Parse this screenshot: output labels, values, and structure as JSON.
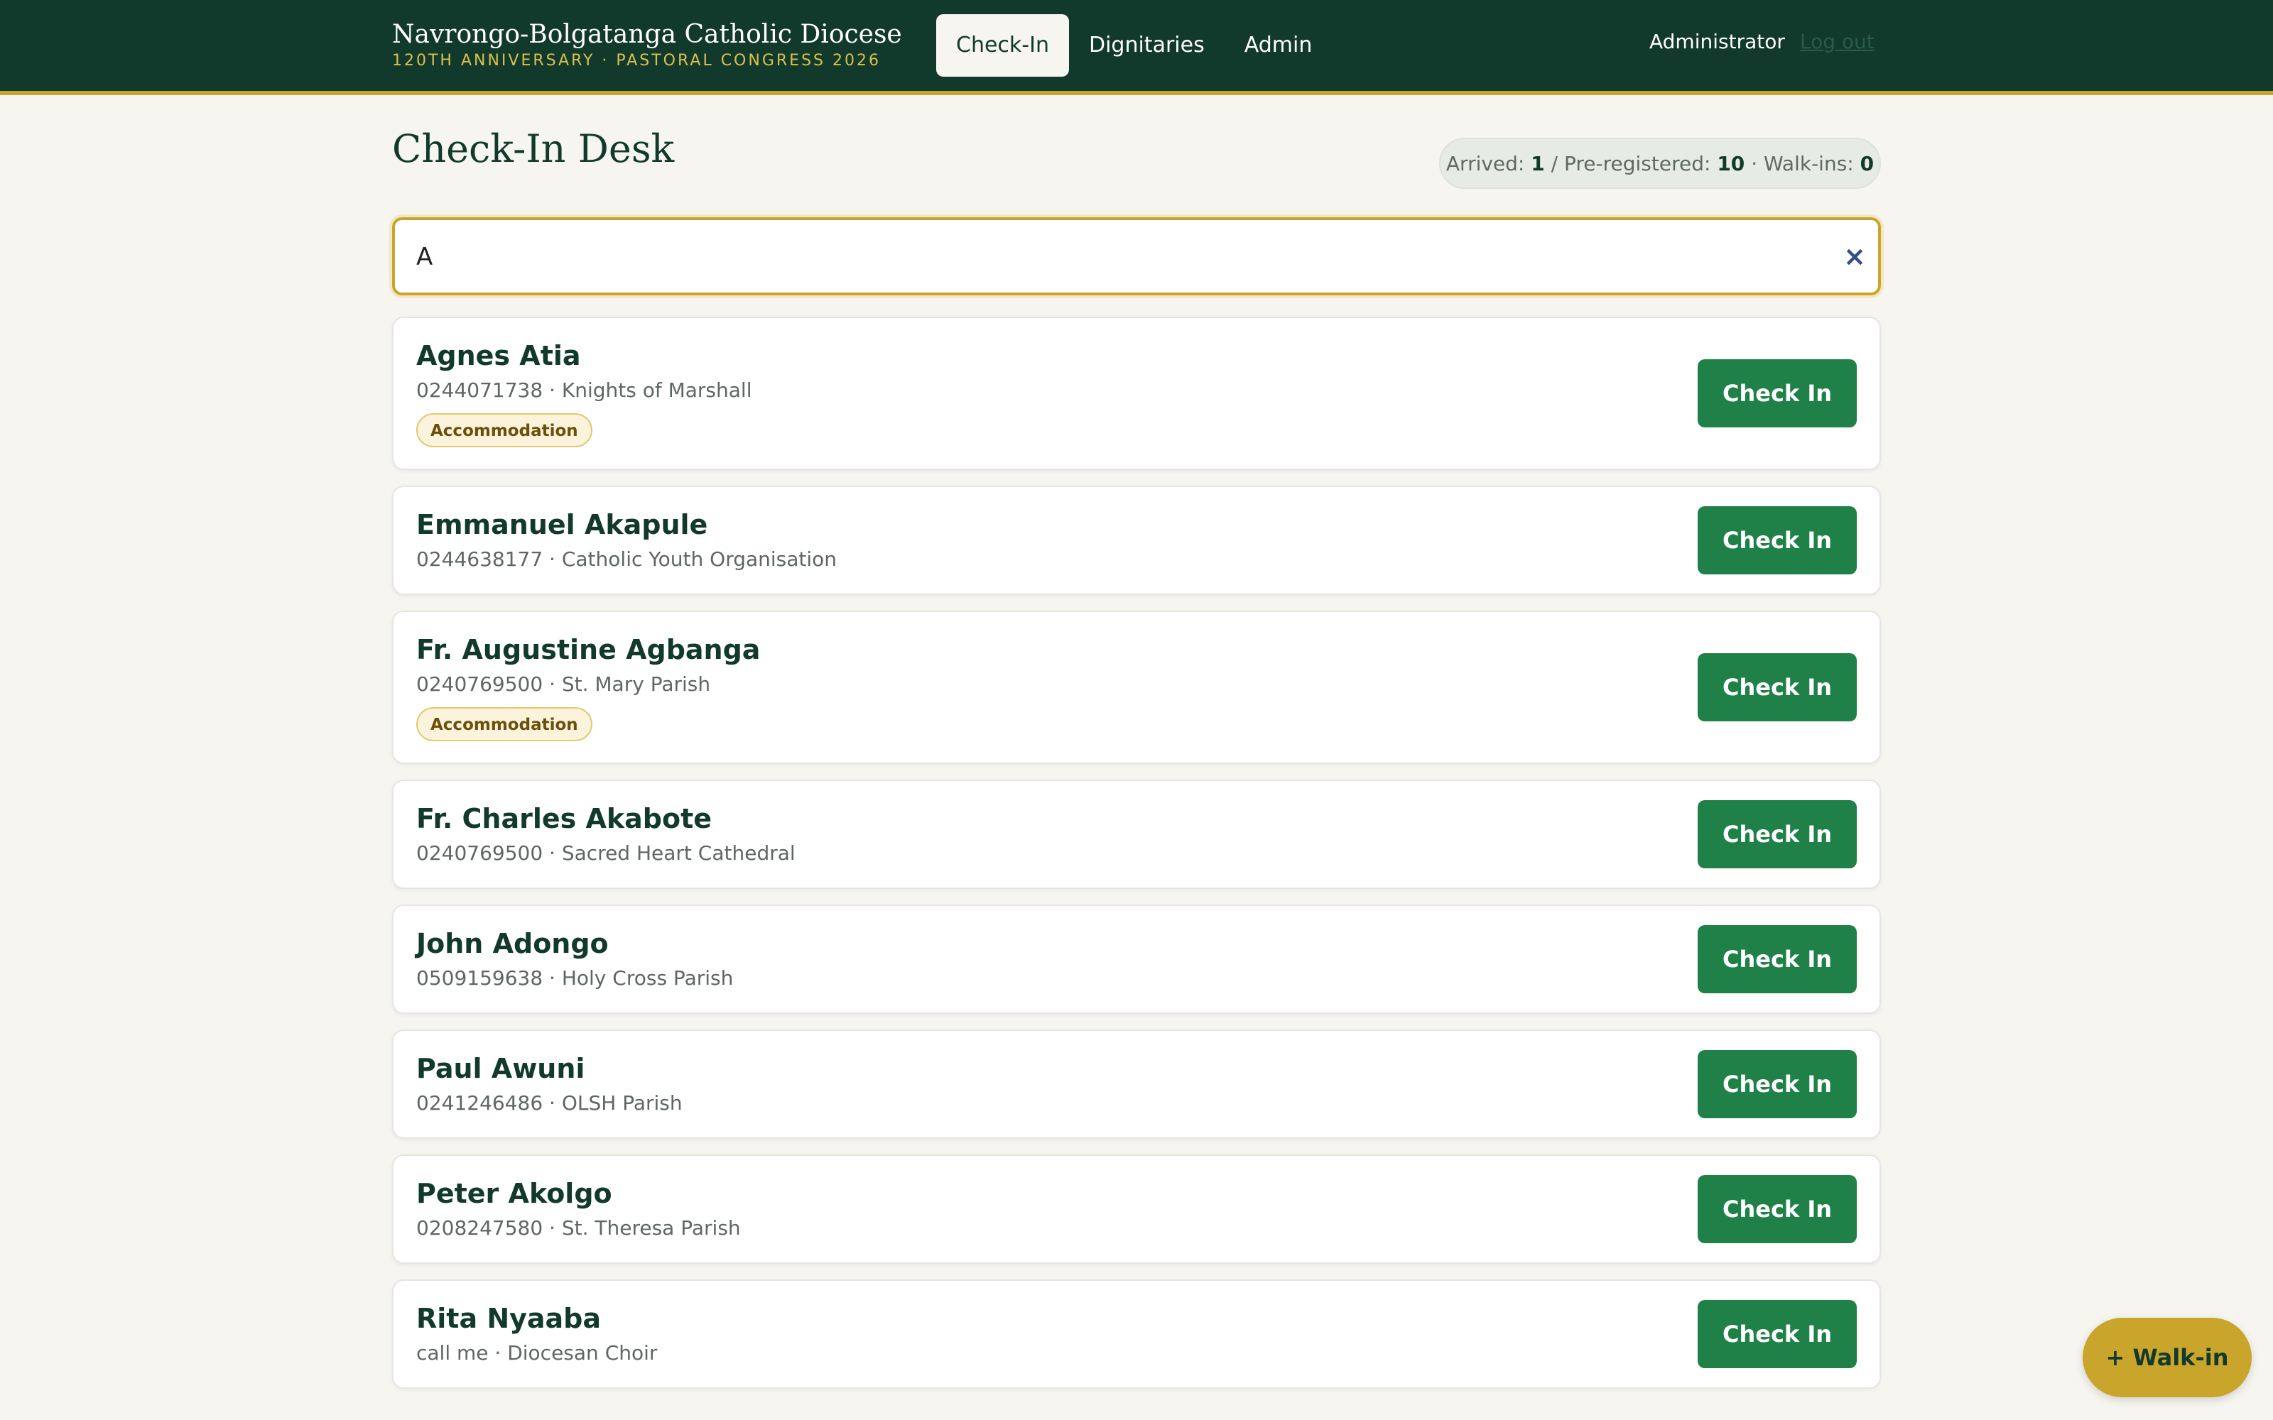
{
  "header": {
    "brand_title": "Navrongo-Bolgatanga Catholic Diocese",
    "brand_subtitle": "120TH ANNIVERSARY · PASTORAL CONGRESS 2026",
    "tabs": [
      {
        "label": "Check-In",
        "active": true
      },
      {
        "label": "Dignitaries",
        "active": false
      },
      {
        "label": "Admin",
        "active": false
      }
    ],
    "user": "Administrator",
    "logout": "Log out"
  },
  "page": {
    "title": "Check-In Desk",
    "stats": {
      "arrived_label": "Arrived:",
      "arrived": "1",
      "sep1": "/",
      "preregistered_label": "Pre-registered:",
      "preregistered": "10",
      "sep2": "·",
      "walkins_label": "Walk-ins:",
      "walkins": "0"
    }
  },
  "search": {
    "value": "A",
    "clear_icon": "×"
  },
  "attendees": [
    {
      "name": "Agnes Atia",
      "meta": "0244071738 · Knights of Marshall",
      "tag": "Accommodation",
      "action": "Check In"
    },
    {
      "name": "Emmanuel Akapule",
      "meta": "0244638177 · Catholic Youth Organisation",
      "tag": "",
      "action": "Check In"
    },
    {
      "name": "Fr. Augustine Agbanga",
      "meta": "0240769500 · St. Mary Parish",
      "tag": "Accommodation",
      "action": "Check In"
    },
    {
      "name": "Fr. Charles Akabote",
      "meta": "0240769500 · Sacred Heart Cathedral",
      "tag": "",
      "action": "Check In"
    },
    {
      "name": "John Adongo",
      "meta": "0509159638 · Holy Cross Parish",
      "tag": "",
      "action": "Check In"
    },
    {
      "name": "Paul Awuni",
      "meta": "0241246486 · OLSH Parish",
      "tag": "",
      "action": "Check In"
    },
    {
      "name": "Peter Akolgo",
      "meta": "0208247580 · St. Theresa Parish",
      "tag": "",
      "action": "Check In"
    },
    {
      "name": "Rita Nyaaba",
      "meta": "call me · Diocesan Choir",
      "tag": "",
      "action": "Check In"
    }
  ],
  "walkin_button": "+ Walk-in",
  "colors": {
    "header_bg": "#123a2c",
    "accent_gold": "#c9a52c",
    "button_green": "#1f8148",
    "page_bg": "#f6f5f0"
  }
}
